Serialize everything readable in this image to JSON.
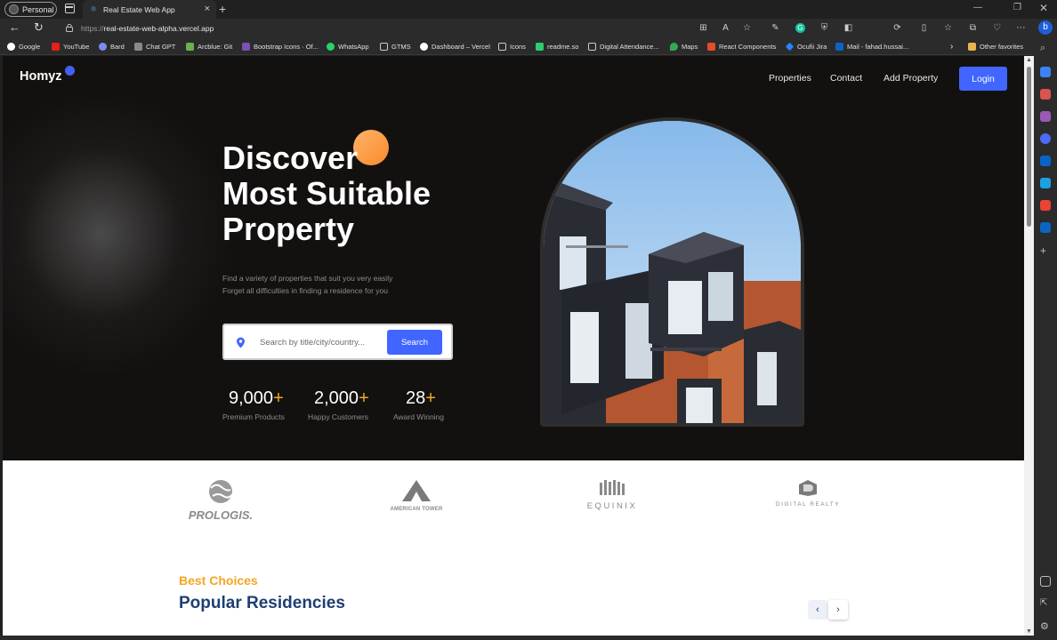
{
  "browser": {
    "profile_label": "Personal",
    "tab_title": "Real Estate Web App",
    "url_scheme": "https://",
    "url_host": "real-estate-web-alpha.vercel.app",
    "bookmarks": [
      "Google",
      "YouTube",
      "Bard",
      "Chat GPT",
      "Arcblue: Git",
      "Bootstrap Icons · Of...",
      "WhatsApp",
      "GTMS",
      "Dashboard – Vercel",
      "Icons",
      "readme.so",
      "Digital Attendance...",
      "Maps",
      "React Components",
      "Ocufii Jira",
      "Mail - fahad.hussai..."
    ],
    "other_favorites": "Other favorites"
  },
  "nav": {
    "logo": "Homyz",
    "links": [
      "Properties",
      "Contact",
      "Add Property"
    ],
    "login": "Login"
  },
  "hero": {
    "headline": [
      "Discover",
      "Most Suitable",
      "Property"
    ],
    "sub_line1": "Find a variety of properties that suit you very easily",
    "sub_line2": "Forget all difficulties in finding a residence for you",
    "search_placeholder": "Search by title/city/country...",
    "search_button": "Search",
    "stats": [
      {
        "value": "9,000",
        "plus": "+",
        "label": "Premium Products"
      },
      {
        "value": "2,000",
        "plus": "+",
        "label": "Happy Customers"
      },
      {
        "value": "28",
        "plus": "+",
        "label": "Award Winning"
      }
    ]
  },
  "partners": [
    "PROLOGIS.",
    "AMERICAN TOWER",
    "EQUINIX",
    "DIGITAL REALTY"
  ],
  "residencies": {
    "eyebrow": "Best Choices",
    "title": "Popular Residencies",
    "prev": "‹",
    "next": "›"
  },
  "colors": {
    "accent": "#4066ff",
    "orange": "#f5a623",
    "navy": "#1f3e72",
    "hero_bg": "#131110"
  }
}
